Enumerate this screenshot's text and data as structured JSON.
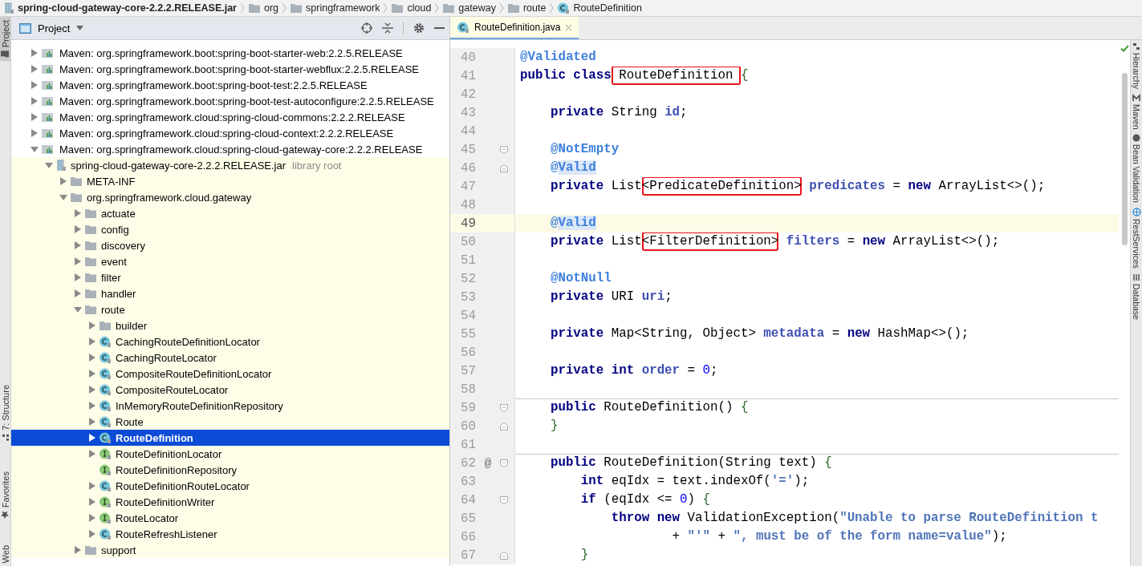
{
  "breadcrumbs": [
    {
      "label": "spring-cloud-gateway-core-2.2.2.RELEASE.jar",
      "kind": "jar"
    },
    {
      "label": "org",
      "kind": "folder"
    },
    {
      "label": "springframework",
      "kind": "folder"
    },
    {
      "label": "cloud",
      "kind": "folder"
    },
    {
      "label": "gateway",
      "kind": "folder"
    },
    {
      "label": "route",
      "kind": "folder"
    },
    {
      "label": "RouteDefinition",
      "kind": "class"
    }
  ],
  "left_strip": [
    {
      "label": "Project",
      "selected": true,
      "kind": "project"
    },
    {
      "label": "7: Structure",
      "selected": false,
      "kind": "structure"
    },
    {
      "label": "Favorites",
      "selected": false,
      "kind": "favorites"
    },
    {
      "label": "Web",
      "selected": false,
      "kind": "web"
    }
  ],
  "project_panel": {
    "title": "Project",
    "tree": [
      {
        "label": "Maven: org.springframework.boot:spring-boot-starter-web:2.2.5.RELEASE",
        "kind": "maven",
        "expanded": false,
        "selected": false
      },
      {
        "label": "Maven: org.springframework.boot:spring-boot-starter-webflux:2.2.5.RELEASE",
        "kind": "maven",
        "expanded": false,
        "selected": false
      },
      {
        "label": "Maven: org.springframework.boot:spring-boot-test:2.2.5.RELEASE",
        "kind": "maven",
        "expanded": false,
        "selected": false
      },
      {
        "label": "Maven: org.springframework.boot:spring-boot-test-autoconfigure:2.2.5.RELEASE",
        "kind": "maven",
        "expanded": false,
        "selected": false
      },
      {
        "label": "Maven: org.springframework.cloud:spring-cloud-commons:2.2.2.RELEASE",
        "kind": "maven",
        "expanded": false,
        "selected": false
      },
      {
        "label": "Maven: org.springframework.cloud:spring-cloud-context:2.2.2.RELEASE",
        "kind": "maven",
        "expanded": false,
        "selected": false
      },
      {
        "label": "Maven: org.springframework.cloud:spring-cloud-gateway-core:2.2.2.RELEASE",
        "kind": "maven",
        "expanded": true,
        "selected": false,
        "children": [
          {
            "label": "spring-cloud-gateway-core-2.2.2.RELEASE.jar",
            "note": "library root",
            "kind": "jar",
            "expanded": true,
            "selected": false,
            "children": [
              {
                "label": "META-INF",
                "kind": "folder",
                "expanded": false,
                "selected": false
              },
              {
                "label": "org.springframework.cloud.gateway",
                "kind": "folder",
                "expanded": true,
                "selected": false,
                "children": [
                  {
                    "label": "actuate",
                    "kind": "folder",
                    "expanded": false,
                    "selected": false
                  },
                  {
                    "label": "config",
                    "kind": "folder",
                    "expanded": false,
                    "selected": false
                  },
                  {
                    "label": "discovery",
                    "kind": "folder",
                    "expanded": false,
                    "selected": false
                  },
                  {
                    "label": "event",
                    "kind": "folder",
                    "expanded": false,
                    "selected": false
                  },
                  {
                    "label": "filter",
                    "kind": "folder",
                    "expanded": false,
                    "selected": false
                  },
                  {
                    "label": "handler",
                    "kind": "folder",
                    "expanded": false,
                    "selected": false
                  },
                  {
                    "label": "route",
                    "kind": "folder",
                    "expanded": true,
                    "selected": false,
                    "children": [
                      {
                        "label": "builder",
                        "kind": "folder",
                        "expanded": false,
                        "selected": false
                      },
                      {
                        "label": "CachingRouteDefinitionLocator",
                        "kind": "class",
                        "expanded": false,
                        "selected": false
                      },
                      {
                        "label": "CachingRouteLocator",
                        "kind": "class",
                        "expanded": false,
                        "selected": false
                      },
                      {
                        "label": "CompositeRouteDefinitionLocator",
                        "kind": "class",
                        "expanded": false,
                        "selected": false
                      },
                      {
                        "label": "CompositeRouteLocator",
                        "kind": "class",
                        "expanded": false,
                        "selected": false
                      },
                      {
                        "label": "InMemoryRouteDefinitionRepository",
                        "kind": "class",
                        "expanded": false,
                        "selected": false
                      },
                      {
                        "label": "Route",
                        "kind": "class",
                        "expanded": false,
                        "selected": false
                      },
                      {
                        "label": "RouteDefinition",
                        "kind": "class",
                        "expanded": false,
                        "selected": true
                      },
                      {
                        "label": "RouteDefinitionLocator",
                        "kind": "interface",
                        "expanded": false,
                        "selected": false
                      },
                      {
                        "label": "RouteDefinitionRepository",
                        "kind": "interface",
                        "selected": false
                      },
                      {
                        "label": "RouteDefinitionRouteLocator",
                        "kind": "class",
                        "expanded": false,
                        "selected": false
                      },
                      {
                        "label": "RouteDefinitionWriter",
                        "kind": "interface",
                        "expanded": false,
                        "selected": false
                      },
                      {
                        "label": "RouteLocator",
                        "kind": "interface",
                        "expanded": false,
                        "selected": false
                      },
                      {
                        "label": "RouteRefreshListener",
                        "kind": "class",
                        "expanded": false,
                        "selected": false
                      }
                    ]
                  },
                  {
                    "label": "support",
                    "kind": "folder",
                    "expanded": false,
                    "selected": false
                  }
                ]
              }
            ]
          }
        ]
      }
    ]
  },
  "editor": {
    "tabs": [
      {
        "label": "RouteDefinition.java",
        "selected": true
      }
    ],
    "lines": [
      {
        "number": "40",
        "tokens": [
          {
            "text": "@Validated",
            "kind": "ann"
          }
        ]
      },
      {
        "number": "41",
        "tokens": [
          {
            "text": "public class",
            "kind": "kw"
          },
          {
            "text": " RouteDefinition ",
            "kind": "plain",
            "boxed": true
          },
          {
            "text": "{",
            "kind": "brace"
          }
        ]
      },
      {
        "number": "42"
      },
      {
        "number": "43",
        "tokens": [
          {
            "text": "    private",
            "kind": "kw"
          },
          {
            "text": " String ",
            "kind": "plain"
          },
          {
            "text": "id",
            "kind": "field"
          },
          {
            "text": ";",
            "kind": "plain"
          }
        ]
      },
      {
        "number": "44"
      },
      {
        "number": "45",
        "fold_start": true,
        "tokens": [
          {
            "text": "    @NotEmpty",
            "kind": "ann"
          }
        ]
      },
      {
        "number": "46",
        "fold_end": true,
        "tokens": [
          {
            "text": "    @",
            "kind": "ann"
          },
          {
            "text": "Valid",
            "kind": "ann",
            "occurrence": true
          }
        ]
      },
      {
        "number": "47",
        "tokens": [
          {
            "text": "    private",
            "kind": "kw"
          },
          {
            "text": " List",
            "kind": "plain"
          },
          {
            "text": "<PredicateDefinition>",
            "kind": "plain",
            "boxed": true
          },
          {
            "text": " predicates",
            "kind": "field"
          },
          {
            "text": " = ",
            "kind": "plain"
          },
          {
            "text": "new",
            "kind": "kw"
          },
          {
            "text": " ArrayList<>();",
            "kind": "plain"
          }
        ]
      },
      {
        "number": "48"
      },
      {
        "number": "49",
        "current": true,
        "tokens": [
          {
            "text": "    @",
            "kind": "ann"
          },
          {
            "text": "Valid",
            "kind": "ann",
            "occurrence": true
          }
        ]
      },
      {
        "number": "50",
        "tokens": [
          {
            "text": "    private",
            "kind": "kw"
          },
          {
            "text": " List",
            "kind": "plain"
          },
          {
            "text": "<FilterDefinition>",
            "kind": "plain",
            "boxed": true
          },
          {
            "text": " filters",
            "kind": "field"
          },
          {
            "text": " = ",
            "kind": "plain"
          },
          {
            "text": "new",
            "kind": "kw"
          },
          {
            "text": " ArrayList<>();",
            "kind": "plain"
          }
        ]
      },
      {
        "number": "51"
      },
      {
        "number": "52",
        "tokens": [
          {
            "text": "    @NotNull",
            "kind": "ann"
          }
        ]
      },
      {
        "number": "53",
        "tokens": [
          {
            "text": "    private",
            "kind": "kw"
          },
          {
            "text": " URI ",
            "kind": "plain"
          },
          {
            "text": "uri",
            "kind": "field"
          },
          {
            "text": ";",
            "kind": "plain"
          }
        ]
      },
      {
        "number": "54"
      },
      {
        "number": "55",
        "tokens": [
          {
            "text": "    private",
            "kind": "kw"
          },
          {
            "text": " Map<String, Object> ",
            "kind": "plain"
          },
          {
            "text": "metadata",
            "kind": "field"
          },
          {
            "text": " = ",
            "kind": "plain"
          },
          {
            "text": "new",
            "kind": "kw"
          },
          {
            "text": " HashMap<>();",
            "kind": "plain"
          }
        ]
      },
      {
        "number": "56"
      },
      {
        "number": "57",
        "tokens": [
          {
            "text": "    private int",
            "kind": "kw"
          },
          {
            "text": " order",
            "kind": "field"
          },
          {
            "text": " = ",
            "kind": "plain"
          },
          {
            "text": "0",
            "kind": "num"
          },
          {
            "text": ";",
            "kind": "plain"
          }
        ]
      },
      {
        "number": "58"
      },
      {
        "number": "59",
        "separator": true,
        "fold_start": true,
        "tokens": [
          {
            "text": "    public",
            "kind": "kw"
          },
          {
            "text": " RouteDefinition() ",
            "kind": "plain"
          },
          {
            "text": "{",
            "kind": "brace"
          }
        ]
      },
      {
        "number": "60",
        "fold_end": true,
        "tokens": [
          {
            "text": "    }",
            "kind": "brace"
          }
        ]
      },
      {
        "number": "61"
      },
      {
        "number": "62",
        "separator": true,
        "fold_start": true,
        "gutter_mark": "@",
        "tokens": [
          {
            "text": "    public",
            "kind": "kw"
          },
          {
            "text": " RouteDefinition(String text) ",
            "kind": "plain"
          },
          {
            "text": "{",
            "kind": "brace"
          }
        ]
      },
      {
        "number": "63",
        "tokens": [
          {
            "text": "        int",
            "kind": "kw"
          },
          {
            "text": " eqIdx = text.indexOf(",
            "kind": "plain"
          },
          {
            "text": "'='",
            "kind": "str"
          },
          {
            "text": ");",
            "kind": "plain"
          }
        ]
      },
      {
        "number": "64",
        "fold_start": true,
        "tokens": [
          {
            "text": "        if",
            "kind": "kw"
          },
          {
            "text": " (eqIdx <= ",
            "kind": "plain"
          },
          {
            "text": "0",
            "kind": "num"
          },
          {
            "text": ") ",
            "kind": "plain"
          },
          {
            "text": "{",
            "kind": "brace"
          }
        ]
      },
      {
        "number": "65",
        "tokens": [
          {
            "text": "            throw new",
            "kind": "kw"
          },
          {
            "text": " ValidationException(",
            "kind": "plain"
          },
          {
            "text": "\"Unable to parse RouteDefinition t",
            "kind": "str"
          }
        ]
      },
      {
        "number": "66",
        "tokens": [
          {
            "text": "                    + ",
            "kind": "plain"
          },
          {
            "text": "\"'\"",
            "kind": "str"
          },
          {
            "text": " + ",
            "kind": "plain"
          },
          {
            "text": "\", must be of the form name=value\"",
            "kind": "str"
          },
          {
            "text": ");",
            "kind": "plain"
          }
        ]
      },
      {
        "number": "67",
        "fold_end": true,
        "tokens": [
          {
            "text": "        }",
            "kind": "brace"
          }
        ]
      }
    ]
  },
  "right_strip": [
    {
      "label": "Hierarchy",
      "kind": "hierarchy"
    },
    {
      "label": "Maven",
      "kind": "maven"
    },
    {
      "label": "Bean Validation",
      "kind": "bean"
    },
    {
      "label": "RestServices",
      "kind": "rest"
    },
    {
      "label": "Database",
      "kind": "database"
    }
  ]
}
